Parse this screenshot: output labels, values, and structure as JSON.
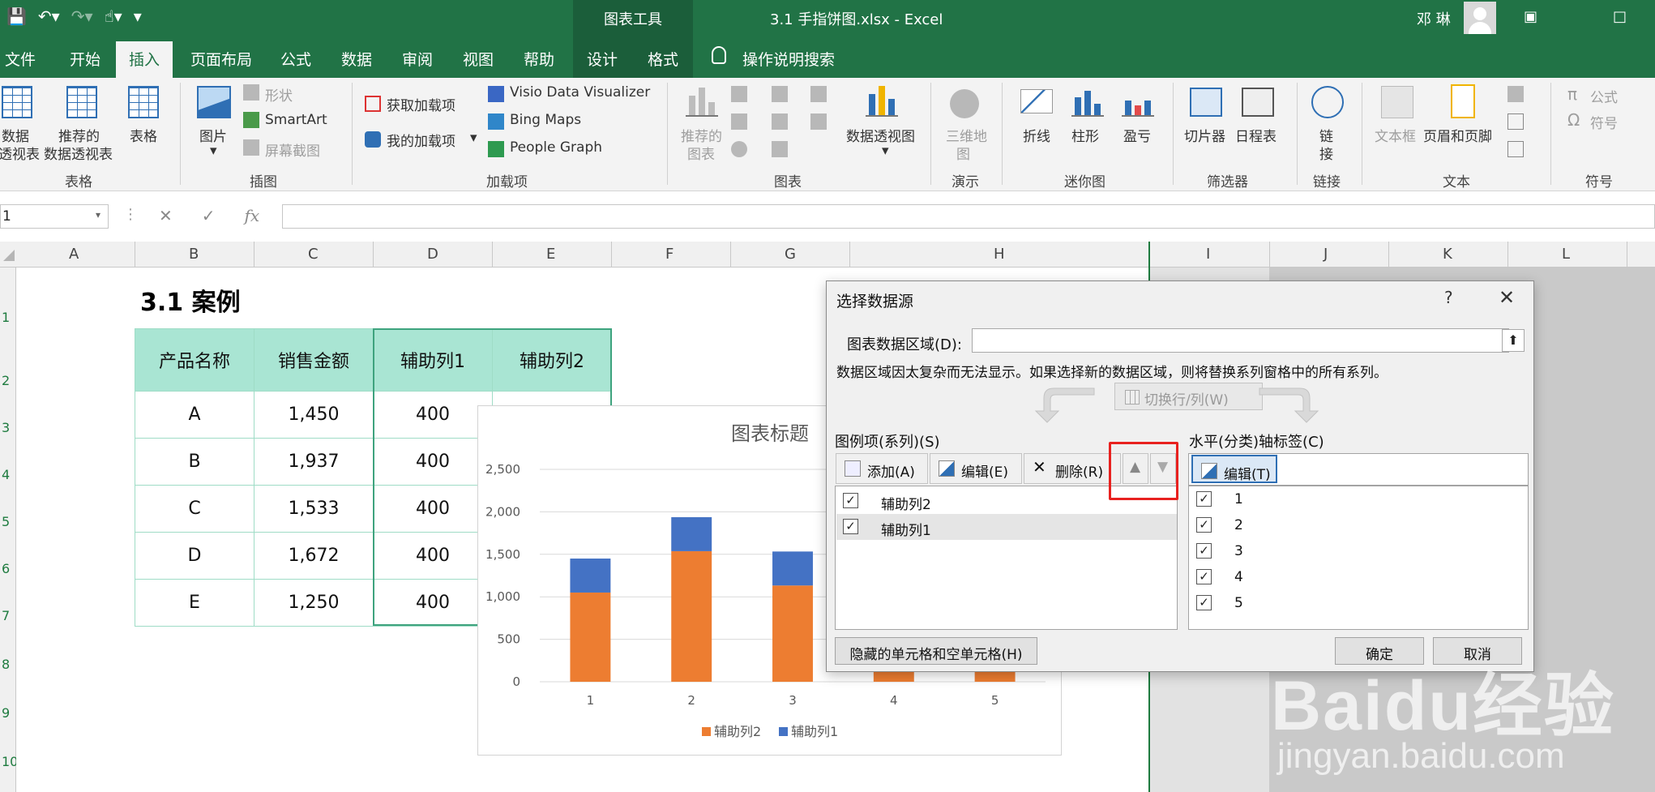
{
  "titlebar": {
    "contextual_title": "图表工具",
    "doc_title": "3.1 手指饼图.xlsx  -  Excel",
    "user_name": "邓 琳"
  },
  "tabs": [
    "文件",
    "开始",
    "插入",
    "页面布局",
    "公式",
    "数据",
    "审阅",
    "视图",
    "帮助",
    "设计",
    "格式"
  ],
  "active_tab": "插入",
  "tell_me": "操作说明搜索",
  "ribbon": {
    "tables": {
      "pivot": [
        "数据",
        "透视表"
      ],
      "recommended_pivot": [
        "推荐的",
        "数据透视表"
      ],
      "table": "表格",
      "group": "表格"
    },
    "illustrations": {
      "pictures": "图片",
      "shapes": "形状",
      "smartart": "SmartArt",
      "screenshot": "屏幕截图",
      "group": "插图"
    },
    "addins": {
      "get": "获取加载项",
      "my": "我的加载项",
      "visio": "Visio Data Visualizer",
      "bing": "Bing Maps",
      "people": "People Graph",
      "group": "加载项"
    },
    "charts": {
      "recommended": [
        "推荐的",
        "图表"
      ],
      "pivotchart": "数据透视图",
      "group": "图表"
    },
    "tours": {
      "map3d": [
        "三维地",
        "图"
      ],
      "group": "演示"
    },
    "sparklines": {
      "line": "折线",
      "column": "柱形",
      "winloss": "盈亏",
      "group": "迷你图"
    },
    "filters": {
      "slicer": "切片器",
      "timeline": "日程表",
      "group": "筛选器"
    },
    "links": {
      "link": [
        "链",
        "接"
      ],
      "group": "链接"
    },
    "text": {
      "textbox": "文本框",
      "header": "页眉和页脚",
      "group": "文本"
    },
    "symbols": {
      "equation": "公式",
      "symbol": "符号",
      "group": "符号"
    }
  },
  "namebox": "1",
  "columns": [
    "A",
    "B",
    "C",
    "D",
    "E",
    "F",
    "G",
    "H",
    "I",
    "J",
    "K",
    "L"
  ],
  "rows": [
    "1",
    "2",
    "3",
    "4",
    "5",
    "6",
    "7",
    "8",
    "9",
    "10"
  ],
  "sheet": {
    "heading": "3.1 案例",
    "table_headers": [
      "产品名称",
      "销售金额",
      "辅助列1",
      "辅助列2"
    ],
    "table_rows": [
      [
        "A",
        "1,450",
        "400"
      ],
      [
        "B",
        "1,937",
        "400"
      ],
      [
        "C",
        "1,533",
        "400"
      ],
      [
        "D",
        "1,672",
        "400"
      ],
      [
        "E",
        "1,250",
        "400"
      ]
    ]
  },
  "chart_data": {
    "type": "bar",
    "stacked": true,
    "title": "图表标题",
    "categories": [
      "1",
      "2",
      "3",
      "4",
      "5"
    ],
    "series": [
      {
        "name": "辅助列2",
        "values": [
          1050,
          1537,
          1133,
          1272,
          850
        ],
        "color": "#ed7d31"
      },
      {
        "name": "辅助列1",
        "values": [
          400,
          400,
          400,
          400,
          400
        ],
        "color": "#4472c4"
      }
    ],
    "y_ticks": [
      "0",
      "500",
      "1,000",
      "1,500",
      "2,000",
      "2,500"
    ],
    "ylim": [
      0,
      2500
    ],
    "legend_position": "bottom",
    "grid": true
  },
  "dialog": {
    "title": "选择数据源",
    "help": "?",
    "close": "✕",
    "range_label": "图表数据区域(D):",
    "range_value": "",
    "range_message": "数据区域因太复杂而无法显示。如果选择新的数据区域，则将替换系列窗格中的所有系列。",
    "switch_label": "切换行/列(W)",
    "legend_label": "图例项(系列)(S)",
    "add": "添加(A)",
    "edit": "编辑(E)",
    "delete": "删除(R)",
    "series": [
      {
        "name": "辅助列2",
        "checked": true,
        "selected": false
      },
      {
        "name": "辅助列1",
        "checked": true,
        "selected": true
      }
    ],
    "axis_label": "水平(分类)轴标签(C)",
    "axis_edit": "编辑(T)",
    "axis_items": [
      "1",
      "2",
      "3",
      "4",
      "5"
    ],
    "hidden_cells": "隐藏的单元格和空单元格(H)",
    "ok": "确定",
    "cancel": "取消"
  },
  "watermark": {
    "logo": "Baidu经验",
    "url": "jingyan.baidu.com"
  }
}
